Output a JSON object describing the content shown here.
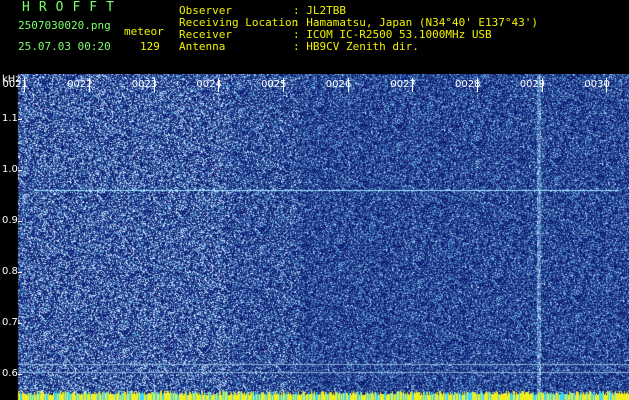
{
  "header": {
    "app_title": "HROFFT",
    "filename": "2507030020.png",
    "mode_label": "meteor",
    "datetime": "25.07.03 00:20",
    "count": "129",
    "info": [
      {
        "key": "Observer",
        "value": "JL2TBB"
      },
      {
        "key": "Receiving Location",
        "value": "Hamamatsu, Japan (N34°40' E137°43')"
      },
      {
        "key": "Receiver",
        "value": "ICOM IC-R2500 53.1000MHz USB"
      },
      {
        "key": "Antenna",
        "value": "HB9CV Zenith dir."
      }
    ],
    "info_separator": ":"
  },
  "colors": {
    "header_green": "#7cff6a",
    "header_yellow": "#f2f200",
    "background": "#000000",
    "carrier_line": "#9fe6ff",
    "noise_bar": "#f0f020"
  },
  "chart_data": {
    "type": "heatmap",
    "y_unit": "kHz",
    "y_ticks": [
      "1.1",
      "1.0",
      "0.9",
      "0.8",
      "0.7",
      "0.6"
    ],
    "y_tick_values": [
      1.1,
      1.0,
      0.9,
      0.8,
      0.7,
      0.6
    ],
    "ylim": [
      0.58,
      1.18
    ],
    "x_ticks": [
      "0021",
      "0022",
      "0023",
      "0024",
      "0025",
      "0026",
      "0027",
      "0028",
      "0029",
      "0030"
    ],
    "x_tick_values": [
      21,
      22,
      23,
      24,
      25,
      26,
      27,
      28,
      29,
      30
    ],
    "xlim": [
      20.9,
      30.35
    ],
    "carrier_khz": 0.96,
    "carrier_x_range": [
      21.15,
      30.2
    ],
    "guide_lines_khz": [
      0.62,
      0.604
    ],
    "meteor_trails": [
      28.95
    ]
  }
}
